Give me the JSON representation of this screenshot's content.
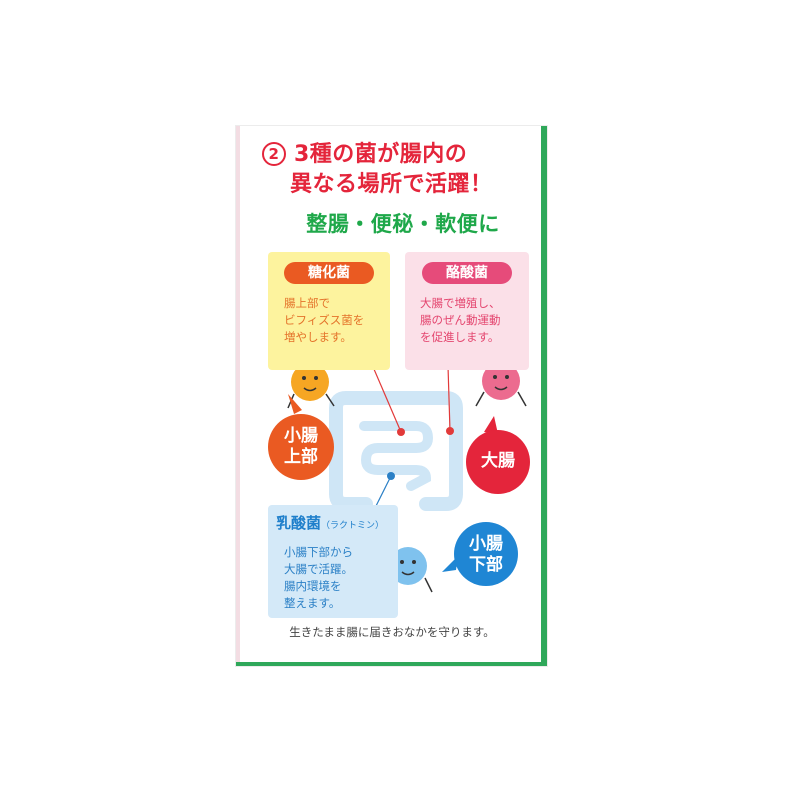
{
  "headline": {
    "number": "2",
    "line1": "3種の菌が腸内の",
    "line2": "異なる場所で活躍！"
  },
  "subheadline": "整腸・便秘・軟便に",
  "bacteria": {
    "saccharifying": {
      "name": "糖化菌",
      "lines": [
        "腸上部で",
        "ビフィズス菌を",
        "増やします。"
      ]
    },
    "butyric": {
      "name": "酪酸菌",
      "lines": [
        "大腸で増殖し、",
        "腸のぜん動運動",
        "を促進します。"
      ]
    },
    "lactic": {
      "name": "乳酸菌",
      "note": "（ラクトミン）",
      "lines": [
        "小腸下部から",
        "大腸で活躍。",
        "腸内環境を",
        "整えます。"
      ]
    }
  },
  "bubbles": {
    "upper_small_intestine": [
      "小腸",
      "上部"
    ],
    "large_intestine": "大腸",
    "lower_small_intestine": [
      "小腸",
      "下部"
    ]
  },
  "footer": "生きたまま腸に届きおなかを守ります。",
  "colors": {
    "red": "#e4253b",
    "green": "#1fa84a",
    "orange": "#ea5a22",
    "pink": "#e64b7a",
    "blue": "#1f86d4",
    "yellow_box": "#fdf39e",
    "pink_box": "#fbe0e8",
    "blue_box": "#d4e9f8",
    "intestine": "#cfe6f6"
  }
}
